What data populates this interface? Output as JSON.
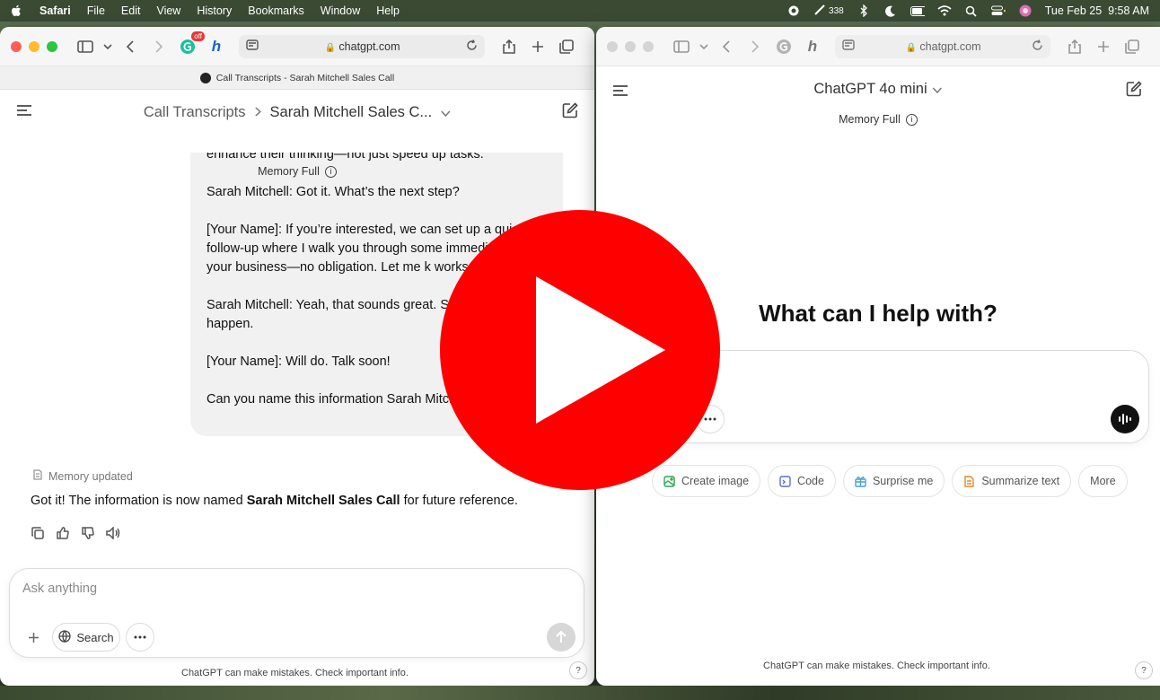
{
  "menubar": {
    "app_name": "Safari",
    "items": [
      "File",
      "Edit",
      "View",
      "History",
      "Bookmarks",
      "Window",
      "Help"
    ],
    "status_count": "338",
    "datetime": "Tue Feb 25  9:58 AM"
  },
  "left_window": {
    "url": "chatgpt.com",
    "extension_badge": "off",
    "tab_title": "Call Transcripts - Sarah Mitchell Sales Call",
    "breadcrumb_parent": "Call Transcripts",
    "breadcrumb_current": "Sarah Mitchell Sales C...",
    "memory_label": "Memory Full",
    "bubble_lines": [
      "enhance their thinking—not just speed up tasks.",
      "Sarah Mitchell: Got it. What’s the next step?",
      "[Your Name]: If you’re interested, we can set up a qui follow-up where I walk you through some immedi wins for your business—no obligation. Let me k works for you.",
      "Sarah Mitchell: Yeah, that sounds great. S and I’ll make it happen.",
      "[Your Name]: Will do. Talk soon!",
      "Can you name this information Sarah Mitche"
    ],
    "memory_updated": "Memory updated",
    "answer_prefix": "Got it! The information is now named ",
    "answer_bold": "Sarah Mitchell Sales Call",
    "answer_suffix": " for future reference.",
    "composer_placeholder": "Ask anything",
    "search_label": "Search",
    "disclaimer": "ChatGPT can make mistakes. Check important info.",
    "help": "?"
  },
  "right_window": {
    "url": "chatgpt.com",
    "model_name": "ChatGPT 4o mini",
    "memory_label": "Memory Full",
    "greeting": "What can I help with?",
    "composer_partial_label": "h",
    "chips": [
      {
        "label": "Create image",
        "icon": "image-icon",
        "color": "#2ea44f"
      },
      {
        "label": "Code",
        "icon": "code-icon",
        "color": "#5b6bd6"
      },
      {
        "label": "Surprise me",
        "icon": "gift-icon",
        "color": "#4aa3c8"
      },
      {
        "label": "Summarize text",
        "icon": "document-icon",
        "color": "#e08a2c"
      },
      {
        "label": "More",
        "icon": "",
        "color": ""
      }
    ],
    "disclaimer": "ChatGPT can make mistakes. Check important info.",
    "help": "?"
  },
  "colors": {
    "play_red": "#ff0000",
    "accent_green": "#2ea44f"
  }
}
